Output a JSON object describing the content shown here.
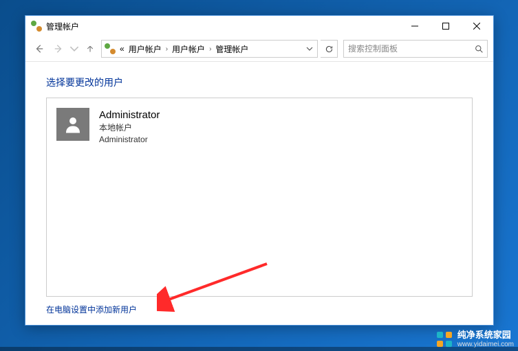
{
  "window": {
    "title": "管理帐户"
  },
  "breadcrumb": {
    "prefix": "«",
    "seg1": "用户帐户",
    "seg2": "用户帐户",
    "seg3": "管理帐户"
  },
  "search": {
    "placeholder": "搜索控制面板"
  },
  "section": {
    "heading": "选择要更改的用户"
  },
  "user": {
    "name": "Administrator",
    "type": "本地帐户",
    "role": "Administrator"
  },
  "link": {
    "add_user": "在电脑设置中添加新用户"
  },
  "watermark": {
    "line1": "纯净系统家园",
    "line2": "www.yidaimei.com"
  }
}
